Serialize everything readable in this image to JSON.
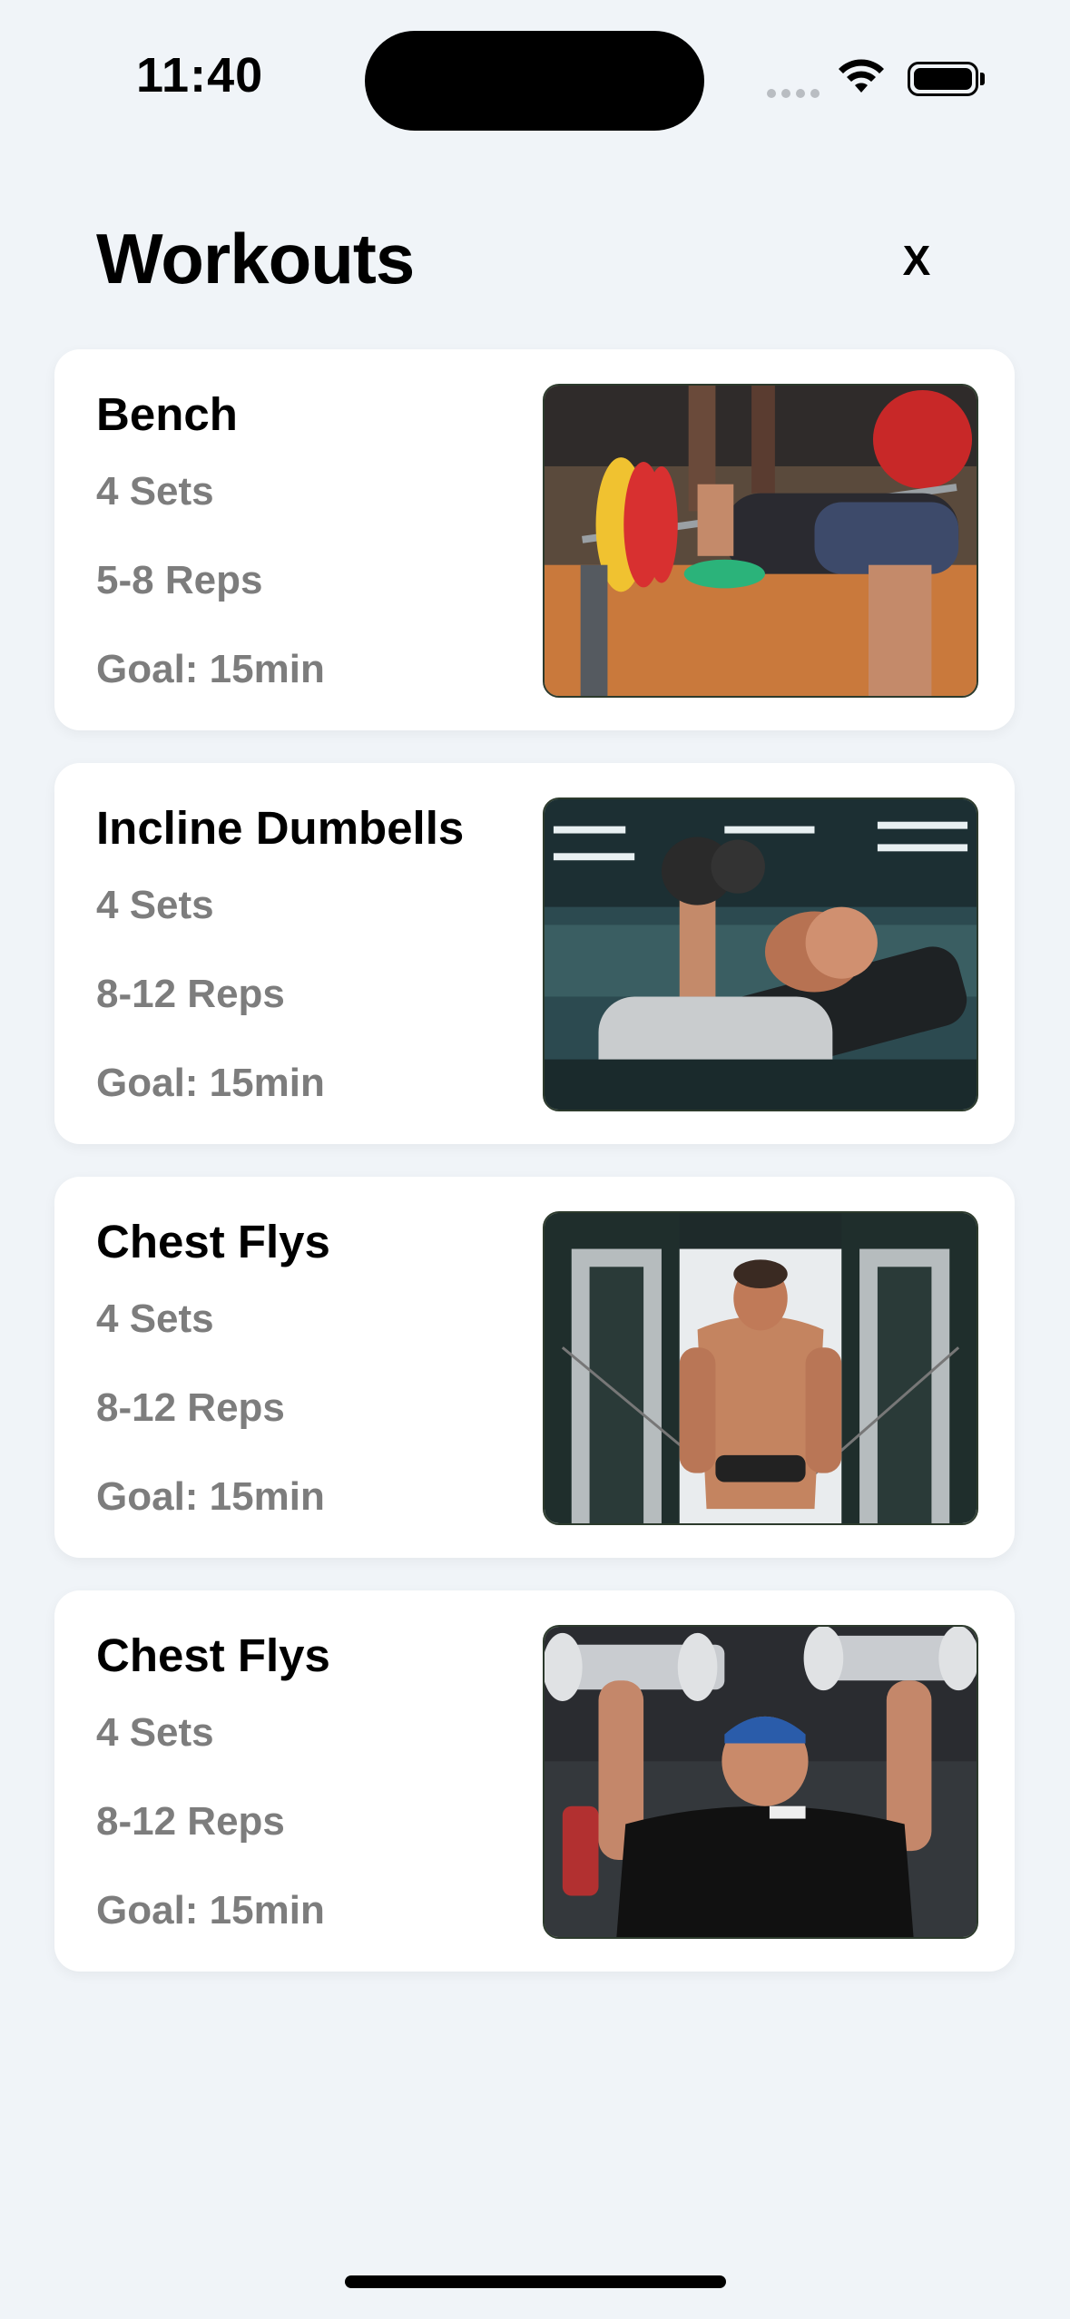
{
  "status_bar": {
    "time": "11:40"
  },
  "header": {
    "title": "Workouts",
    "close_label": "X"
  },
  "workouts": [
    {
      "name": "Bench",
      "sets": "4 Sets",
      "reps": "5-8 Reps",
      "goal": "Goal: 15min",
      "image": "bench-press-photo"
    },
    {
      "name": "Incline Dumbells",
      "sets": "4 Sets",
      "reps": "8-12 Reps",
      "goal": "Goal: 15min",
      "image": "incline-dumbbell-press-photo"
    },
    {
      "name": "Chest Flys",
      "sets": "4 Sets",
      "reps": "8-12 Reps",
      "goal": "Goal: 15min",
      "image": "cable-chest-fly-photo"
    },
    {
      "name": "Chest Flys",
      "sets": "4 Sets",
      "reps": "8-12 Reps",
      "goal": "Goal: 15min",
      "image": "dumbbell-shoulder-press-photo"
    }
  ]
}
